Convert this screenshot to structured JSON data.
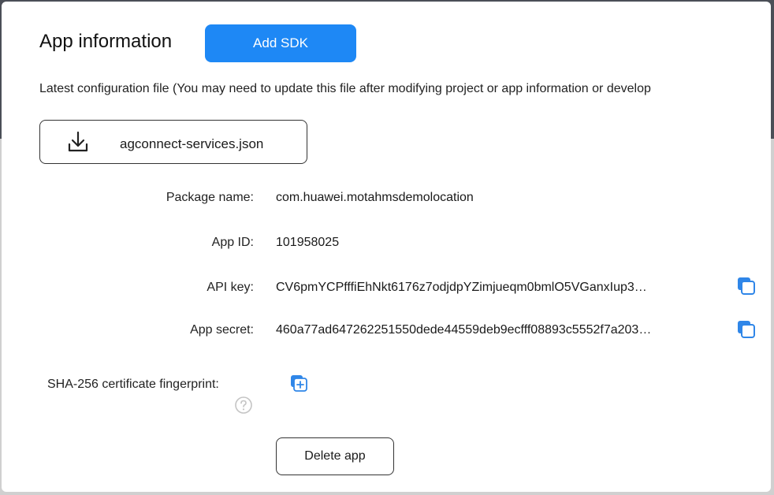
{
  "header": {
    "title": "App information",
    "add_sdk_label": "Add SDK"
  },
  "config": {
    "note": "Latest configuration file (You may need to update this file after modifying project or app information or develop",
    "file_name": "agconnect-services.json",
    "download_icon": "download-icon"
  },
  "fields": {
    "package_name": {
      "label": "Package name:",
      "value": "com.huawei.motahmsdemolocation"
    },
    "app_id": {
      "label": "App ID:",
      "value": "101958025"
    },
    "api_key": {
      "label": "API key:",
      "value": "CV6pmYCPfffiEhNkt6176z7odjdpYZimjueqm0bmlO5VGanxIup3…",
      "icon": "copy-icon"
    },
    "app_secret": {
      "label": "App secret:",
      "value": "460a77ad647262251550dede44559deb9ecfff08893c5552f7a203…",
      "icon": "copy-icon"
    }
  },
  "sha": {
    "label": "SHA-256 certificate fingerprint:",
    "help_icon": "help-icon",
    "add_icon": "add-fingerprint-icon"
  },
  "actions": {
    "delete_label": "Delete app"
  },
  "colors": {
    "accent": "#1e88f5",
    "backdrop": "#4b4f57",
    "icon_blue": "#2f86e8"
  }
}
